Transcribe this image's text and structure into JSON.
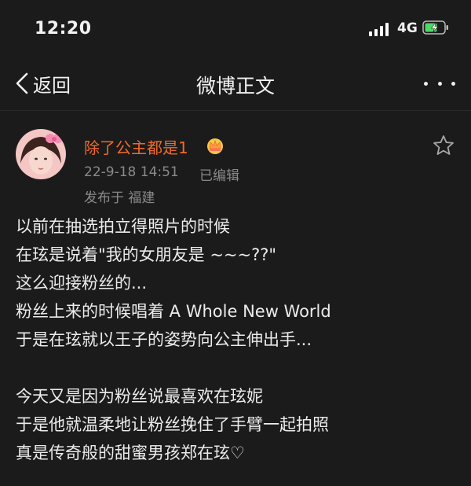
{
  "status_bar": {
    "time": "12:20",
    "network": "4G"
  },
  "nav": {
    "back_label": "返回",
    "title": "微博正文"
  },
  "post": {
    "author_name": "除了公主都是1",
    "time": "22-9-18 14:51",
    "edited": "已编辑",
    "location": "发布于 福建",
    "lines": [
      "以前在抽选拍立得照片的时候",
      "在玹是说着\"我的女朋友是 ~~~??\"",
      "这么迎接粉丝的...",
      "粉丝上来的时候唱着 A Whole New World",
      "于是在玹就以王子的姿势向公主伸出手...",
      "",
      "今天又是因为粉丝说最喜欢在玹妮",
      "于是他就温柔地让粉丝挽住了手臂一起拍照",
      "真是传奇般的甜蜜男孩郑在玹♡"
    ]
  },
  "colors": {
    "background": "#1b1b1b",
    "author_accent": "#f06a2a",
    "meta_text": "#8a8a8a",
    "battery_green": "#4cd964"
  },
  "icons": [
    "signal-icon",
    "battery-charging-icon",
    "chevron-left-icon",
    "more-dots-icon",
    "crown-badge-icon",
    "star-outline-icon"
  ]
}
